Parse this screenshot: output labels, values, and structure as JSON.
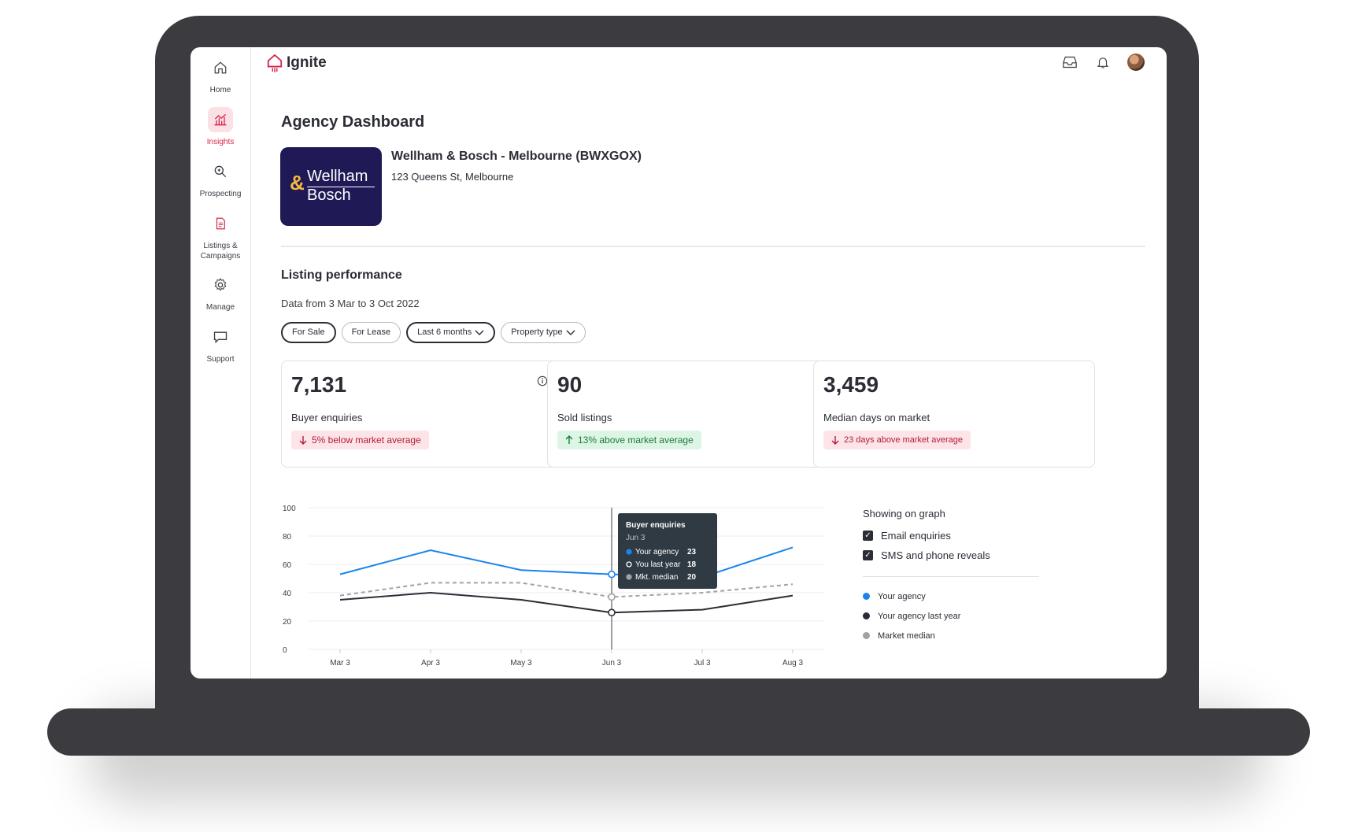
{
  "app": {
    "name": "Ignite"
  },
  "sidebar": {
    "items": [
      {
        "label": "Home",
        "icon": "home-icon"
      },
      {
        "label": "Insights",
        "icon": "insights-chart-icon",
        "active": true
      },
      {
        "label": "Prospecting",
        "icon": "prospecting-search-icon"
      },
      {
        "label": "Listings &\nCampaigns",
        "icon": "document-icon"
      },
      {
        "label": "Manage",
        "icon": "gear-icon"
      },
      {
        "label": "Support",
        "icon": "chat-bubble-icon"
      }
    ]
  },
  "topbar": {
    "icons": [
      "inbox-icon",
      "bell-icon",
      "avatar"
    ]
  },
  "page": {
    "title": "Agency Dashboard"
  },
  "agency": {
    "logo_amp": "&",
    "logo_line1": "Wellham",
    "logo_line2": "Bosch",
    "name": "Wellham & Bosch - Melbourne (BWXGOX)",
    "address": "123 Queens St, Melbourne"
  },
  "performance": {
    "title": "Listing performance",
    "date_range": "Data from 3 Mar to 3 Oct 2022",
    "filters": [
      {
        "label": "For Sale",
        "selected": true
      },
      {
        "label": "For Lease",
        "selected": false
      },
      {
        "label": "Last 6 months",
        "selected": true,
        "dropdown": true
      },
      {
        "label": "Property type",
        "selected": false,
        "dropdown": true
      }
    ]
  },
  "cards": [
    {
      "value": "7,131",
      "label": "Buyer enquiries",
      "badge": "5% below market average",
      "trend": "down",
      "status_color": "#b11d3a"
    },
    {
      "value": "90",
      "label": "Sold listings",
      "badge": "13% above market average",
      "trend": "up",
      "status_color": "#1d7a3a"
    },
    {
      "value": "3,459",
      "label": "Median days on market",
      "badge": "23 days above market average",
      "trend": "down",
      "status_color": "#b11d3a"
    }
  ],
  "chart_data": {
    "type": "line",
    "x": [
      "Mar 3",
      "Apr 3",
      "May 3",
      "Jun 3",
      "Jul 3",
      "Aug 3"
    ],
    "yticks": [
      0,
      20,
      40,
      60,
      80,
      100
    ],
    "ylim": [
      0,
      100
    ],
    "grid": true,
    "series": [
      {
        "name": "Your agency",
        "color": "#1a84ee",
        "dash": false,
        "values": [
          53,
          70,
          56,
          53,
          51,
          72
        ]
      },
      {
        "name": "Your agency last year",
        "color": "#2b2d36",
        "dash": false,
        "values": [
          35,
          40,
          35,
          26,
          28,
          38
        ]
      },
      {
        "name": "Market median",
        "color": "#a0a2a8",
        "dash": true,
        "values": [
          38,
          47,
          47,
          37,
          40,
          46
        ]
      }
    ],
    "tooltip": {
      "title": "Buyer enquiries",
      "date": "Jun 3",
      "rows": [
        {
          "label": "Your agency",
          "value": "23"
        },
        {
          "label": "You last year",
          "value": "18"
        },
        {
          "label": "Mkt. median",
          "value": "20"
        }
      ]
    }
  },
  "graph_options": {
    "title": "Showing on graph",
    "checkboxes": [
      {
        "label": "Email enquiries",
        "checked": true
      },
      {
        "label": "SMS and phone reveals",
        "checked": true
      }
    ]
  },
  "legend": [
    {
      "label": "Your agency",
      "color": "#1a84ee"
    },
    {
      "label": "Your agency last year",
      "color": "#2b2d36"
    },
    {
      "label": "Market median",
      "color": "#a0a2a8"
    }
  ]
}
